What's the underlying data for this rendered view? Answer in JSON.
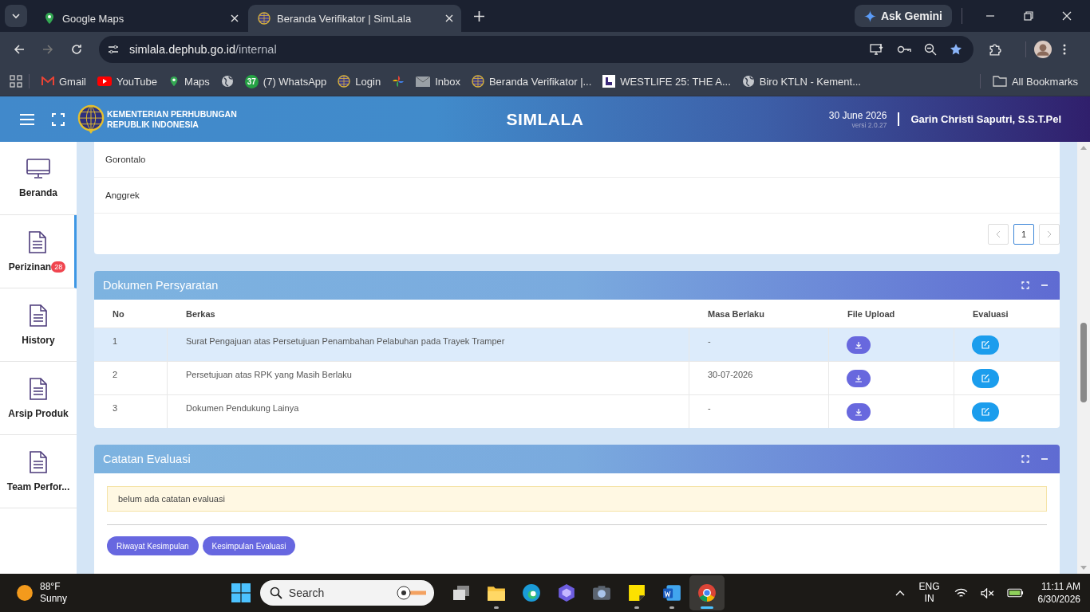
{
  "browser": {
    "tabs": [
      {
        "title": "Google Maps",
        "kind": "maps",
        "selected": false
      },
      {
        "title": "Beranda Verifikator | SimLala",
        "kind": "globe-logo",
        "selected": true
      }
    ],
    "gemini": "Ask Gemini",
    "url": {
      "host": "simlala.dephub.go.id",
      "path": "/internal"
    },
    "bookmarks": [
      {
        "label": "Gmail",
        "kind": "gmail"
      },
      {
        "label": "YouTube",
        "kind": "youtube"
      },
      {
        "label": "Maps",
        "kind": "maps"
      },
      {
        "kind": "globe"
      },
      {
        "label": "(7) WhatsApp",
        "kind": "whatsapp",
        "badge": "37"
      },
      {
        "label": "Login",
        "kind": "globe-logo"
      },
      {
        "kind": "pinwheel"
      },
      {
        "label": "Inbox",
        "kind": "mail"
      },
      {
        "label": "Beranda Verifikator |...",
        "kind": "globe-logo"
      },
      {
        "label": "WESTLIFE 25: THE A...",
        "kind": "square-logo"
      },
      {
        "label": "Biro KTLN - Kement...",
        "kind": "globe"
      }
    ],
    "all_bookmarks": "All Bookmarks"
  },
  "header": {
    "org": [
      "KEMENTERIAN PERHUBUNGAN",
      "REPUBLIK INDONESIA"
    ],
    "app_title": "SIMLALA",
    "date": "30 June 2026",
    "version": "versi 2.0.27",
    "user": "Garin Christi Saputri, S.S.T.Pel"
  },
  "sidebar": [
    {
      "label": "Beranda",
      "kind": "monitor",
      "selected": false
    },
    {
      "label": "Perizinan",
      "kind": "document",
      "badge": "28",
      "selected": true
    },
    {
      "label": "History",
      "kind": "document",
      "selected": false
    },
    {
      "label": "Arsip Produk",
      "kind": "document",
      "selected": false
    },
    {
      "label": "Team Perfor...",
      "kind": "document",
      "selected": false
    }
  ],
  "location_list": {
    "rows": [
      "Gorontalo",
      "Anggrek"
    ],
    "pages": [
      {
        "label": "1",
        "selected": true
      }
    ]
  },
  "documents": {
    "title": "Dokumen Persyaratan",
    "columns": [
      "No",
      "Berkas",
      "Masa Berlaku",
      "File Upload",
      "Evaluasi"
    ],
    "rows": [
      {
        "no": "1",
        "berkas": "Surat Pengajuan atas Persetujuan Penambahan Pelabuhan pada Trayek Tramper",
        "masa_berlaku": "-",
        "selected": true
      },
      {
        "no": "2",
        "berkas": "Persetujuan atas RPK yang Masih Berlaku",
        "masa_berlaku": "30-07-2026",
        "selected": false
      },
      {
        "no": "3",
        "berkas": "Dokumen Pendukung Lainya",
        "masa_berlaku": "-",
        "selected": false
      }
    ]
  },
  "evaluation": {
    "title": "Catatan Evaluasi",
    "message": "belum ada catatan evaluasi",
    "buttons": [
      "Riwayat Kesimpulan",
      "Kesimpulan Evaluasi"
    ]
  },
  "taskbar": {
    "weather": {
      "temp": "88°F",
      "condition": "Sunny"
    },
    "search_placeholder": "Search",
    "apps": [
      {
        "kind": "task-view",
        "running": false,
        "selected": false
      },
      {
        "kind": "folder",
        "running": true,
        "selected": false
      },
      {
        "kind": "edge",
        "running": false,
        "selected": false
      },
      {
        "kind": "copilot",
        "running": false,
        "selected": false
      },
      {
        "kind": "camera",
        "running": false,
        "selected": false
      },
      {
        "kind": "notes",
        "running": true,
        "selected": false
      },
      {
        "kind": "word",
        "running": true,
        "selected": false
      },
      {
        "kind": "chrome",
        "running": true,
        "selected": true
      }
    ],
    "lang": [
      "ENG",
      "IN"
    ],
    "time": "11:11 AM",
    "date": "6/30/2026"
  }
}
